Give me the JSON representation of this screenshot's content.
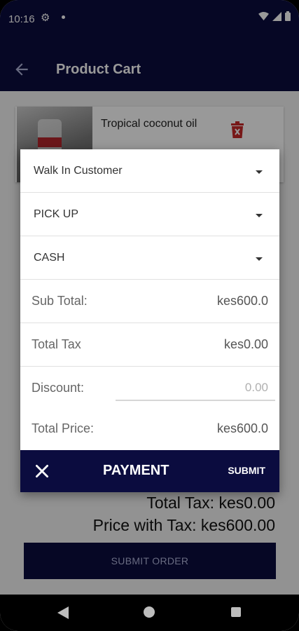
{
  "status": {
    "time": "10:16"
  },
  "appbar": {
    "title": "Product Cart"
  },
  "cart": {
    "items": [
      {
        "name": "Tropical coconut oil"
      }
    ],
    "total_tax_line": "Total Tax: kes0.00",
    "price_with_tax_line": "Price with Tax: kes600.00",
    "submit_order_label": "SUBMIT ORDER"
  },
  "dialog": {
    "customer": "Walk In Customer",
    "delivery": "PICK UP",
    "payment_method": "CASH",
    "subtotal_label": "Sub Total:",
    "subtotal_value": "kes600.0",
    "tax_label": "Total Tax",
    "tax_value": "kes0.00",
    "discount_label": "Discount:",
    "discount_placeholder": "0.00",
    "total_label": "Total Price:",
    "total_value": "kes600.0",
    "title": "PAYMENT",
    "submit_label": "SUBMIT"
  },
  "icons": {
    "back": "arrow-back-icon",
    "delete": "trash-icon",
    "close": "close-icon",
    "caret": "chevron-down-icon"
  },
  "colors": {
    "primary": "#0b0c3f",
    "delete": "#c62828"
  }
}
